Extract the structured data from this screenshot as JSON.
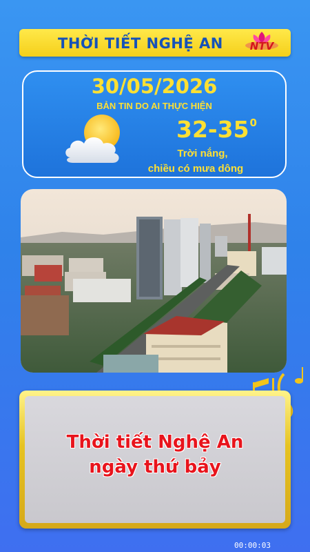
{
  "header": {
    "title": "THỜI TIẾT NGHỆ AN",
    "logo_text": "NTV",
    "logo_icon": "ntv-lotus-logo"
  },
  "forecast": {
    "date": "30/05/2026",
    "subtitle": "BẢN TIN DO AI THỰC HIỆN",
    "icon": "sun-behind-cloud-icon",
    "temperature": "32-35",
    "temperature_unit": "0",
    "description_line1": "Trời nắng,",
    "description_line2": "chiều có mưa dông"
  },
  "photo": {
    "icon": "city-aerial-photo"
  },
  "message": {
    "line1": "Thời tiết Nghệ An",
    "line2": "ngày thứ bảy"
  },
  "decoration": {
    "icon": "music-notes-icon"
  },
  "video": {
    "timestamp": "00:00:03"
  },
  "colors": {
    "background": "#3a96f2",
    "accent_yellow": "#ffe033",
    "title_blue": "#1652b8",
    "message_red": "#e8141c"
  }
}
